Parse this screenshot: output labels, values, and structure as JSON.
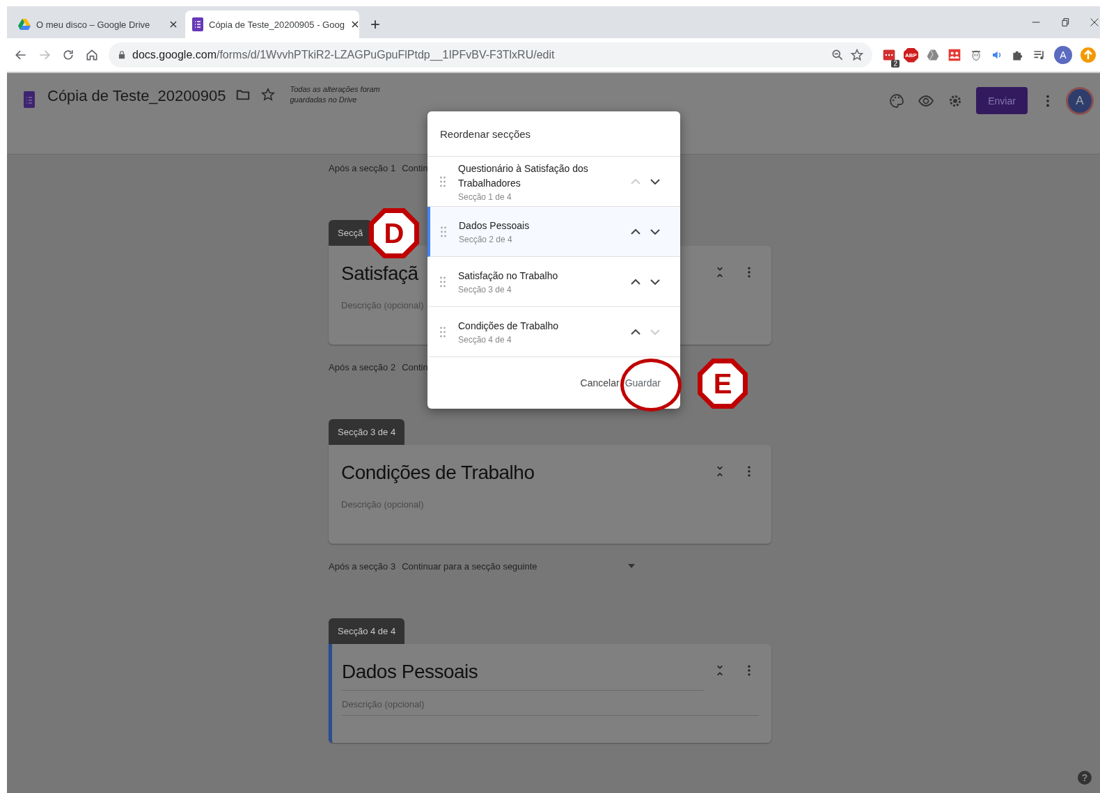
{
  "browser": {
    "tabs": [
      {
        "title": "O meu disco – Google Drive",
        "selected": false
      },
      {
        "title": "Cópia de Teste_20200905 - Goog",
        "selected": true
      }
    ],
    "new_tab": "+",
    "url_host": "docs.google.com",
    "url_path": "/forms/d/1WvvhPTkiR2-LZAGPuGpuFlPtdp__1IPFvBV-F3TlxRU/edit",
    "extension_badge": "2",
    "adblock_label": "ABP",
    "profile_initial": "A"
  },
  "form_header": {
    "title": "Cópia de Teste_20200905",
    "save_status": "Todas as alterações foram guardadas no Drive",
    "send_button": "Enviar",
    "avatar_initial": "A"
  },
  "form_items": [
    {
      "kind": "after",
      "label": "Após a secção 1",
      "action": "Contin"
    },
    {
      "kind": "section",
      "tab": "Secçã",
      "title": "Satisfaçã",
      "description": "Descrição (opcional)",
      "focused": false
    },
    {
      "kind": "after",
      "label": "Após a secção 2",
      "action": "Contin"
    },
    {
      "kind": "section",
      "tab": "Secção 3 de 4",
      "title": "Condições de Trabalho",
      "description": "Descrição (opcional)",
      "focused": false
    },
    {
      "kind": "after",
      "label": "Após a secção 3",
      "action": "Continuar para a secção seguinte"
    },
    {
      "kind": "section",
      "tab": "Secção 4 de 4",
      "title": "Dados Pessoais",
      "description": "Descrição (opcional)",
      "focused": true
    }
  ],
  "dialog": {
    "title": "Reordenar secções",
    "rows": [
      {
        "title": "Questionário à Satisfação dos Trabalhadores",
        "subtitle": "Secção 1 de 4",
        "selected": false,
        "up_disabled": true,
        "down_disabled": false
      },
      {
        "title": "Dados Pessoais",
        "subtitle": "Secção 2 de 4",
        "selected": true,
        "up_disabled": false,
        "down_disabled": false
      },
      {
        "title": "Satisfação no Trabalho",
        "subtitle": "Secção 3 de 4",
        "selected": false,
        "up_disabled": false,
        "down_disabled": false
      },
      {
        "title": "Condições de Trabalho",
        "subtitle": "Secção 4 de 4",
        "selected": false,
        "up_disabled": false,
        "down_disabled": true
      }
    ],
    "buttons": [
      {
        "label": "Cancelar",
        "kind": "cancel"
      },
      {
        "label": "Guardar",
        "kind": "confirm"
      }
    ]
  },
  "annotations": [
    {
      "label": "D"
    },
    {
      "label": "E"
    }
  ],
  "help_button": "?"
}
